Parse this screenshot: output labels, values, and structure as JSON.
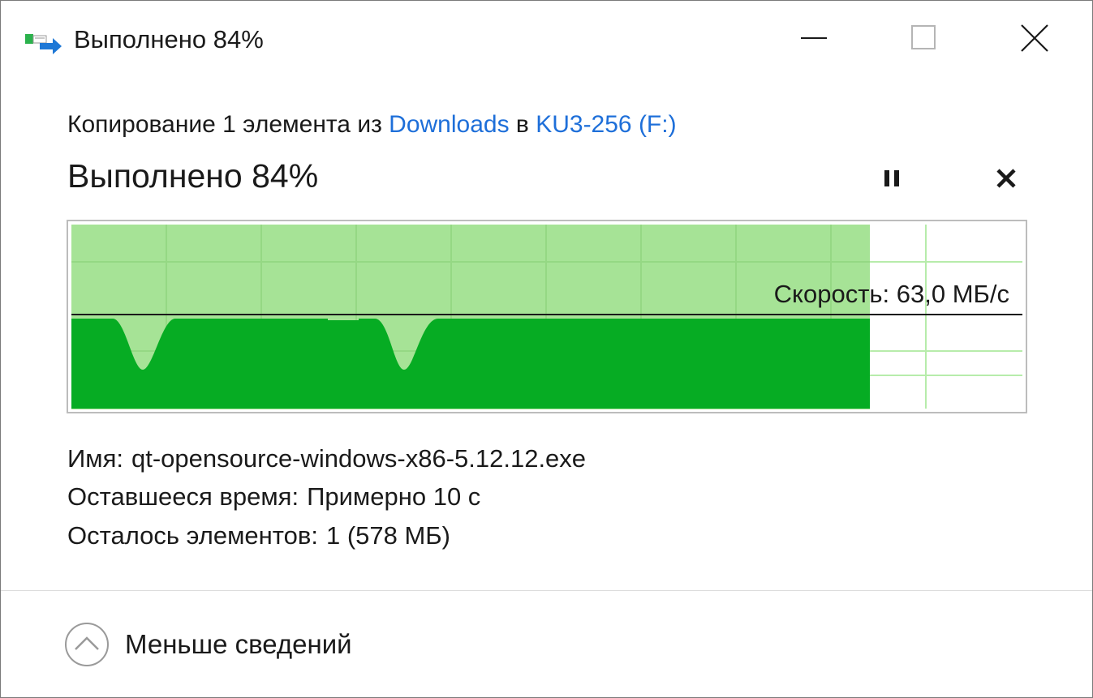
{
  "window": {
    "title": "Выполнено 84%",
    "icon": "file-copy-icon"
  },
  "header": {
    "copy_prefix": "Копирование 1 элемента из ",
    "source": "Downloads",
    "connector": " в ",
    "destination": "KU3-256 (F:)",
    "progress_title": "Выполнено 84%"
  },
  "progress": {
    "percent": 84
  },
  "speed": {
    "label": "Скорость: 63,0 МБ/с"
  },
  "details": {
    "name_label": "Имя:",
    "name_value": "qt-opensource-windows-x86-5.12.12.exe",
    "time_label": "Оставшееся время:",
    "time_value": "Примерно 10 с",
    "items_label": "Осталось элементов:",
    "items_value": "1 (578 МБ)"
  },
  "footer": {
    "less_details": "Меньше сведений"
  },
  "colors": {
    "progress_fill": "#a6e396",
    "speed_fill": "#06ac23",
    "grid": "#b7ecab",
    "link": "#1e6fd9"
  }
}
